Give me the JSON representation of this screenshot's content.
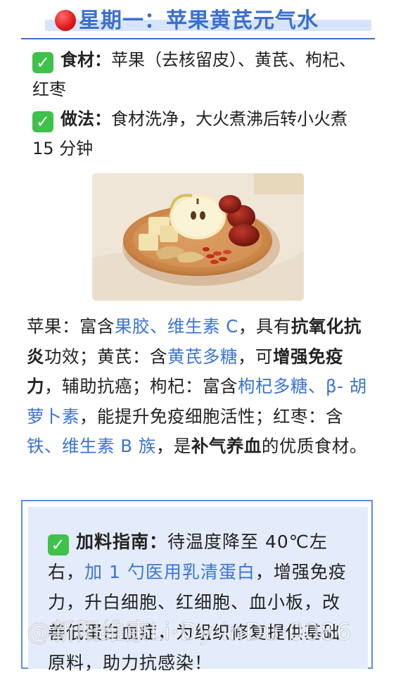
{
  "title": "星期一：苹果黄芪元气水",
  "ingredients": {
    "label": "食材：",
    "text": "苹果（去核留皮）、黄芪、枸杞、红枣"
  },
  "method": {
    "label": "做法：",
    "text": "食材洗净，大火煮沸后转小火煮 15 分钟"
  },
  "body": {
    "s1": "苹果：富含",
    "s2": "果胶、维生素 C",
    "s3": "，具有",
    "s4": "抗氧化抗炎",
    "s5": "功效；黄芪：含",
    "s6": "黄芪多糖",
    "s7": "，可",
    "s8": "增强免疫力",
    "s9": "，辅助抗癌；枸杞：富含",
    "s10": "枸杞多糖、β- 胡萝卜素",
    "s11": "，能提升免疫细胞活性；红枣：含",
    "s12": "铁、维生素 B 族",
    "s13": "，是",
    "s14": "补气养血",
    "s15": "的优质食材。"
  },
  "tip": {
    "label": "加料指南：",
    "t1": "待温度降至 40℃左右，",
    "t2": "加 1 勺医用乳清蛋白",
    "t3": "，增强免疫力，升白细胞、红细胞、血小板，改善低蛋白血症，为组织修复提供基础原料，助力抗感染！"
  },
  "watermark": "@新阳维康Li·Dy·inDu·0086"
}
